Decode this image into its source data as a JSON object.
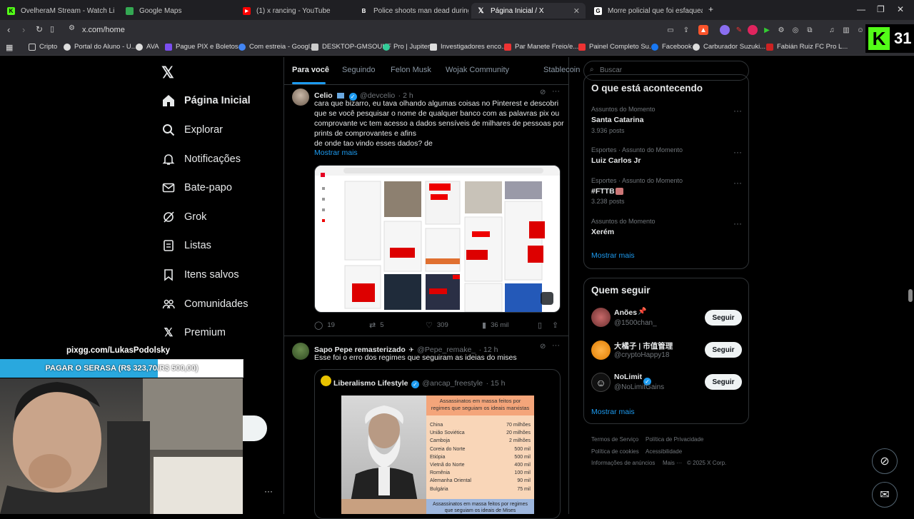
{
  "browser": {
    "tabs": [
      {
        "title": "OvelheraM Stream - Watch Live o"
      },
      {
        "title": "Google Maps"
      },
      {
        "title": "(1) x rancing - YouTube"
      },
      {
        "title": "Police shoots man dead during inter"
      },
      {
        "title": "Página Inicial / X"
      },
      {
        "title": "Morre policial que foi esfaqueado po"
      }
    ],
    "url": "x.com/home",
    "bookmarks": [
      "Cripto",
      "Portal do Aluno - U...",
      "AVA",
      "Pague PIX e Boletos...",
      "Com estreia - Googl...",
      "DESKTOP-GMSOUHF",
      "Pro | Jupiter",
      "Investigadores enco...",
      "Par Manete Freio/e...",
      "Painel Completo Su...",
      "Facebook",
      "Carburador Suzuki...",
      "Fabián Ruiz FC Pro L..."
    ],
    "kick_count": "31"
  },
  "nav": {
    "items": [
      {
        "label": "Página Inicial"
      },
      {
        "label": "Explorar"
      },
      {
        "label": "Notificações"
      },
      {
        "label": "Bate-papo"
      },
      {
        "label": "Grok"
      },
      {
        "label": "Listas"
      },
      {
        "label": "Itens salvos"
      },
      {
        "label": "Comunidades"
      },
      {
        "label": "Premium"
      }
    ]
  },
  "timeline": {
    "tabs": [
      "Para você",
      "Seguindo",
      "Felon Musk",
      "Wojak Community",
      "Stablecoin"
    ],
    "tweets": [
      {
        "name": "Celio",
        "handle": "@devcelio",
        "time": "· 2 h",
        "lines": [
          "cara que bizarro, eu tava olhando algumas coisas no Pinterest e descobri",
          "que se você pesquisar o nome de qualquer banco com as palavras pix ou",
          "comprovante vc tem acesso a dados sensíveis de milhares de pessoas por",
          "prints de comprovantes e afins",
          "de onde tao vindo esses dados? de"
        ],
        "show_more": "Mostrar mais",
        "replies": "19",
        "reposts": "5",
        "likes": "309",
        "views": "36 mil"
      },
      {
        "name": "Sapo Pepe remasterizado",
        "handle": "@Pepe_remake_",
        "time": "· 12 h",
        "text": "Esse foi o erro dos regimes que seguiram as ideias do mises",
        "quote": {
          "name": "Liberalismo Lifestyle",
          "handle": "@ancap_freestyle",
          "time": "· 15 h",
          "table_title": "Assassinatos em massa feitos por regimes que seguiam os ideais marxistas",
          "rows": [
            {
              "country": "China",
              "value": "70 milhões"
            },
            {
              "country": "União Soviética",
              "value": "20 milhões"
            },
            {
              "country": "Camboja",
              "value": "2 milhões"
            },
            {
              "country": "Coreia do Norte",
              "value": "500 mil"
            },
            {
              "country": "Etiópia",
              "value": "500 mil"
            },
            {
              "country": "Vietnã do Norte",
              "value": "400 mil"
            },
            {
              "country": "Romênia",
              "value": "100 mil"
            },
            {
              "country": "Alemanha Oriental",
              "value": "90 mil"
            },
            {
              "country": "Bulgária",
              "value": "75 mil"
            }
          ],
          "table_title_2": "Assassinatos em massa feitos por regimes que seguiam os ideais de Mises"
        }
      }
    ]
  },
  "right": {
    "search_placeholder": "Buscar",
    "trends_title": "O que está acontecendo",
    "trends": [
      {
        "meta": "Assuntos do Momento",
        "name": "Santa Catarina",
        "posts": "3.936 posts"
      },
      {
        "meta": "Esportes · Assunto do Momento",
        "name": "Luiz Carlos Jr",
        "posts": ""
      },
      {
        "meta": "Esportes · Assunto do Momento",
        "name": "#FTTB",
        "posts": "3.238 posts"
      },
      {
        "meta": "Assuntos do Momento",
        "name": "Xerém",
        "posts": ""
      }
    ],
    "show_more": "Mostrar mais",
    "follow_title": "Quem seguir",
    "follow": [
      {
        "name": "Anões",
        "handle": "@1500chan_",
        "button": "Seguir"
      },
      {
        "name": "大橘子 | 市值管理",
        "handle": "@cryptoHappy18",
        "button": "Seguir"
      },
      {
        "name": "NoLimit",
        "handle": "@NoLimitGains",
        "button": "Seguir"
      }
    ],
    "footer": [
      "Termos de Serviço",
      "Política de Privacidade",
      "Política de cookies",
      "Acessibilidade",
      "Informações de anúncios",
      "Mais ···",
      "© 2025 X Corp."
    ]
  },
  "overlay": {
    "donation_url": "pixgg.com/LukasPodolsky",
    "goal_text": "PAGAR O SERASA (R$ 323,70/R$ 500,00)",
    "goal_progress": 0.647
  }
}
